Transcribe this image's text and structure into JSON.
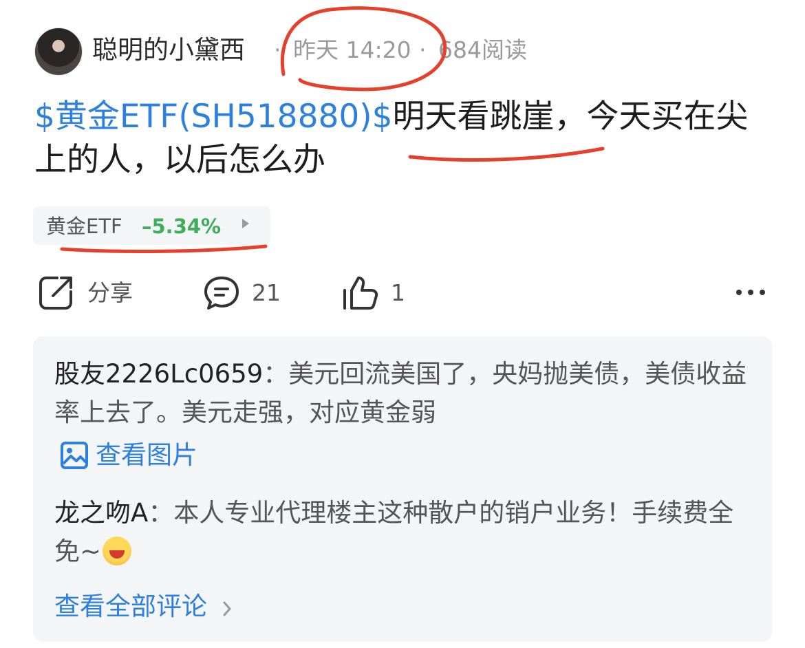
{
  "post": {
    "author": {
      "name": "聪明的小黛西",
      "avatar": "avatar"
    },
    "sep1": "·",
    "time": "昨天 14:20",
    "sep2": "·",
    "reads": "684阅读",
    "ticker": "$黄金ETF(SH518880)$",
    "body": "明天看跳崖，今天买在尖上的人，以后怎么办",
    "stock_chip": {
      "name": "黄金ETF",
      "change": "–5.34%",
      "arrow_icon": "play-arrow-icon",
      "change_color": "#3daf5a"
    }
  },
  "actions": {
    "share_label": "分享",
    "comments_count": "21",
    "likes_count": "1",
    "icons": [
      "share-icon",
      "comment-icon",
      "like-icon",
      "more-icon"
    ]
  },
  "comments": [
    {
      "author": "股友2226Lc0659",
      "sep": "：",
      "text": "美元回流美国了，央妈抛美债，美债收益率上去了。美元走强，对应黄金弱"
    },
    {
      "author": "龙之吻A",
      "sep": "：",
      "text": "本人专业代理楼主这种散户的销户业务！手续费全免~",
      "emoji": "laughing-emoji"
    }
  ],
  "view_image_label": "查看图片",
  "view_all_label": "查看全部评论",
  "colors": {
    "link": "#2d7fe0",
    "annotation": "#e5402b",
    "down_green": "#3daf5a"
  }
}
